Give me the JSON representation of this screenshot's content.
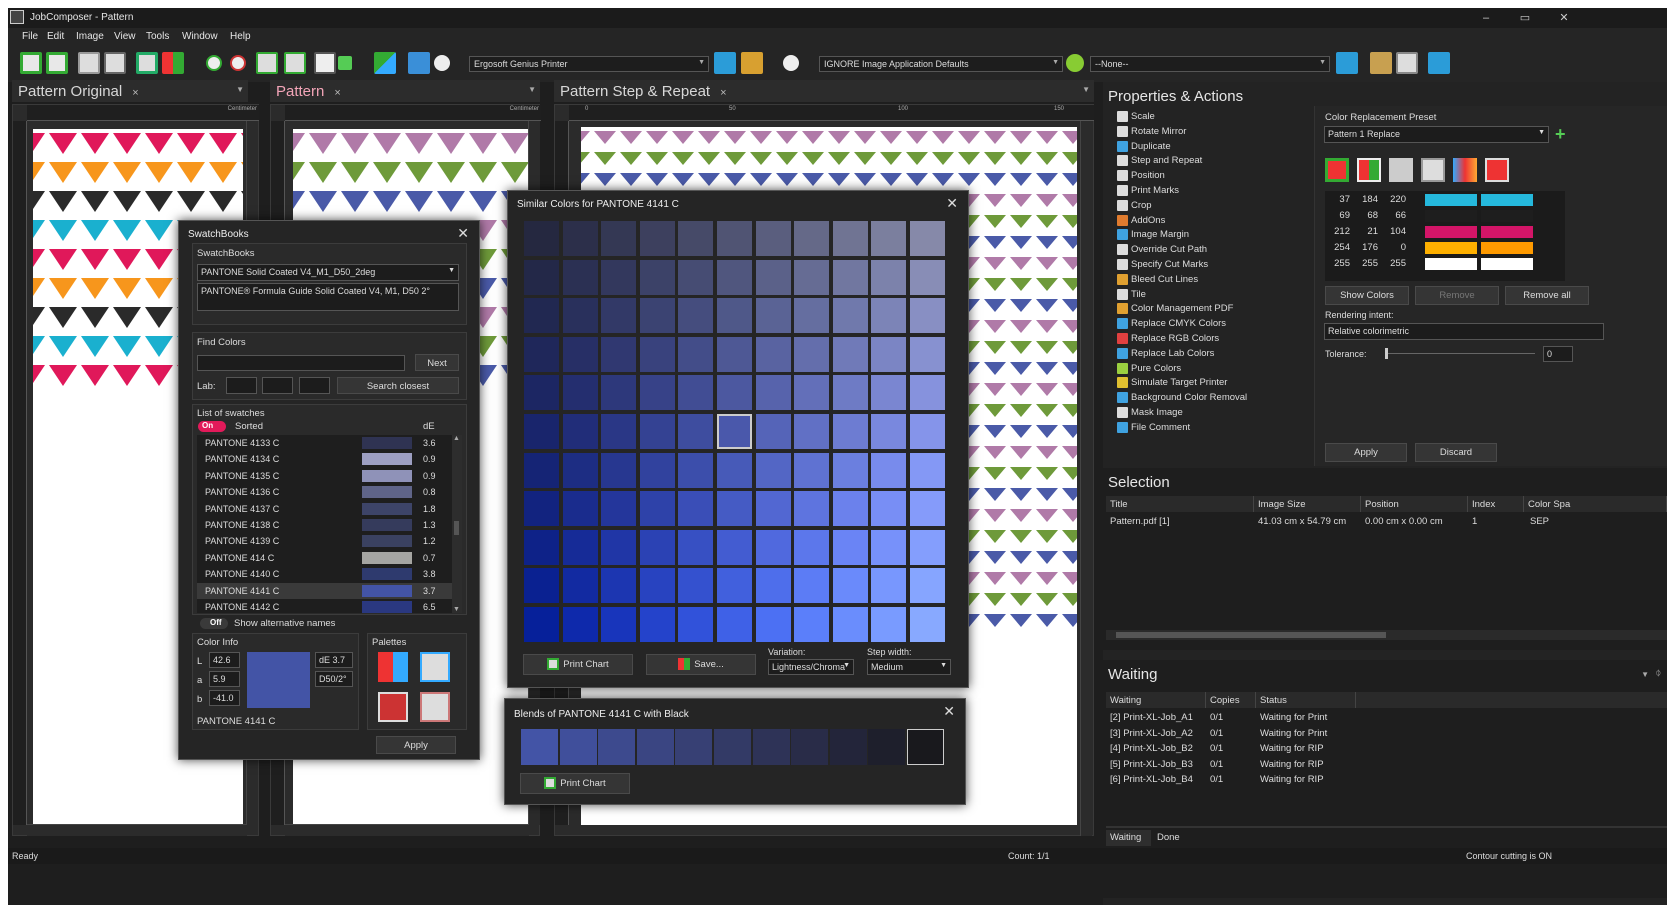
{
  "window": {
    "title": "JobComposer - Pattern",
    "controls": [
      "–",
      "▭",
      "✕"
    ]
  },
  "menu": [
    "File",
    "Edit",
    "Image",
    "View",
    "Tools",
    "Window",
    "Help"
  ],
  "toolbar": {
    "printer": "Ergosoft Genius Printer",
    "image_app": "IGNORE Image Application Defaults",
    "none": "--None--"
  },
  "tabs": [
    {
      "label": "Pattern Original",
      "close": "×"
    },
    {
      "label": "Pattern",
      "close": "×"
    },
    {
      "label": "Pattern Step & Repeat",
      "close": "×"
    }
  ],
  "ruler": {
    "unit": "Centimeter",
    "ticks": [
      "0",
      "50",
      "100",
      "150"
    ]
  },
  "swatchbooks": {
    "title": "SwatchBooks",
    "close": "✕",
    "group": "SwatchBooks",
    "book": "PANTONE Solid Coated V4_M1_D50_2deg",
    "book_desc": "PANTONE® Formula Guide Solid Coated V4, M1, D50 2°",
    "find_title": "Find Colors",
    "find_value": "",
    "next": "Next",
    "lab_label": "Lab:",
    "search_closest": "Search closest",
    "list_title": "List of swatches",
    "toggle_on": "On",
    "sorted": "Sorted",
    "de_header": "dE",
    "swatches": [
      {
        "name": "PANTONE 4133 C",
        "de": "3.6",
        "color": "#2f3352"
      },
      {
        "name": "PANTONE 4134 C",
        "de": "0.9",
        "color": "#9d9fc2"
      },
      {
        "name": "PANTONE 4135 C",
        "de": "0.9",
        "color": "#8f92b8"
      },
      {
        "name": "PANTONE 4136 C",
        "de": "0.8",
        "color": "#5f6488"
      },
      {
        "name": "PANTONE 4137 C",
        "de": "1.8",
        "color": "#3d4468"
      },
      {
        "name": "PANTONE 4138 C",
        "de": "1.3",
        "color": "#353b5c"
      },
      {
        "name": "PANTONE 4139 C",
        "de": "1.2",
        "color": "#3a4160"
      },
      {
        "name": "PANTONE 414 C",
        "de": "0.7",
        "color": "#a5a5a2"
      },
      {
        "name": "PANTONE 4140 C",
        "de": "3.8",
        "color": "#2e3a6e"
      },
      {
        "name": "PANTONE 4141 C",
        "de": "3.7",
        "color": "#4354a6"
      },
      {
        "name": "PANTONE 4142 C",
        "de": "6.5",
        "color": "#2a3880"
      }
    ],
    "toggle_off": "Off",
    "alt_names": "Show alternative names",
    "color_info": "Color Info",
    "L": "42.6",
    "a": "5.9",
    "b": "-41.0",
    "L_label": "L",
    "a_label": "a",
    "b_label": "b",
    "de_value": "dE 3.7",
    "illum": "D50/2°",
    "color_name": "PANTONE 4141 C",
    "preview_color": "#4354a6",
    "palettes": "Palettes",
    "apply": "Apply"
  },
  "similar": {
    "title": "Similar Colors for PANTONE 4141 C",
    "close": "✕",
    "print_chart": "Print Chart",
    "save": "Save...",
    "variation_label": "Variation:",
    "variation": "Lightness/Chroma",
    "step_label": "Step width:",
    "step": "Medium",
    "grid": [
      [
        "#252840",
        "#2c2f4a",
        "#343854",
        "#3d405e",
        "#464a68",
        "#505473",
        "#5a5e7e",
        "#656988",
        "#707493",
        "#7b7f9e",
        "#8689a9"
      ],
      [
        "#232848",
        "#2b3053",
        "#33385d",
        "#3c4268",
        "#464c73",
        "#50567e",
        "#5b6189",
        "#666c94",
        "#7177a0",
        "#7c82ab",
        "#888db6"
      ],
      [
        "#212851",
        "#29305c",
        "#323967",
        "#3b4372",
        "#454d7e",
        "#4f5889",
        "#5a6395",
        "#656ea0",
        "#7079ac",
        "#7c84b7",
        "#888fc3"
      ],
      [
        "#1f275a",
        "#272f66",
        "#303871",
        "#39427d",
        "#434d89",
        "#4e5895",
        "#5963a1",
        "#646eac",
        "#707ab8",
        "#7b85c4",
        "#8791d0"
      ],
      [
        "#1c2663",
        "#242e6f",
        "#2d387b",
        "#374288",
        "#414d94",
        "#4c58a0",
        "#5763ac",
        "#636fb9",
        "#6e7bc5",
        "#7a86d1",
        "#8692dd"
      ],
      [
        "#19256c",
        "#212d79",
        "#2a3786",
        "#344293",
        "#3e4d9f",
        "#4a58ab",
        "#5564b8",
        "#6170c5",
        "#6d7cd2",
        "#7988de",
        "#8594ea"
      ],
      [
        "#152475",
        "#1d2d83",
        "#273790",
        "#31429e",
        "#3c4eab",
        "#475ab8",
        "#5366c5",
        "#5f72d2",
        "#6b7fdf",
        "#788bec",
        "#8498f5"
      ],
      [
        "#12237f",
        "#1a2c8d",
        "#24369b",
        "#2e42a9",
        "#3a4eb7",
        "#455bc4",
        "#5267d2",
        "#5e74df",
        "#6b81ec",
        "#788ef5",
        "#859bfa"
      ],
      [
        "#0e2288",
        "#162b97",
        "#2036a6",
        "#2b42b4",
        "#3750c3",
        "#435cd1",
        "#5069de",
        "#5c77eb",
        "#6a84f5",
        "#7791fa",
        "#849efd"
      ],
      [
        "#0a2191",
        "#122aa1",
        "#1c36b1",
        "#2843c0",
        "#3451cf",
        "#4160dd",
        "#4e6eeb",
        "#5c7cf5",
        "#6a8afb",
        "#7897fe",
        "#86a5ff"
      ],
      [
        "#06209a",
        "#0e29ab",
        "#1835bb",
        "#2443cb",
        "#3152da",
        "#3f61e7",
        "#4c70f3",
        "#5b7ffa",
        "#6a8dfd",
        "#799bff",
        "#88a9ff"
      ]
    ]
  },
  "blends": {
    "title": "Blends of PANTONE 4141 C with Black",
    "close": "✕",
    "print_chart": "Print Chart",
    "colors": [
      "#4354a6",
      "#404f9b",
      "#3d4a8e",
      "#3a4582",
      "#374074",
      "#333a66",
      "#2e3357",
      "#292c48",
      "#23253a",
      "#1e1f2c",
      "#19191d"
    ]
  },
  "properties": {
    "title": "Properties & Actions",
    "items": [
      {
        "label": "Scale",
        "icon": "scale-icon",
        "color": "#dddddd"
      },
      {
        "label": "Rotate Mirror",
        "icon": "rotate-icon",
        "color": "#dddddd"
      },
      {
        "label": "Duplicate",
        "icon": "duplicate-icon",
        "color": "#3fa2e0"
      },
      {
        "label": "Step and Repeat",
        "icon": "step-repeat-icon",
        "color": "#dddddd"
      },
      {
        "label": "Position",
        "icon": "position-icon",
        "color": "#dddddd"
      },
      {
        "label": "Print Marks",
        "icon": "print-marks-icon",
        "color": "#dddddd"
      },
      {
        "label": "Crop",
        "icon": "crop-icon",
        "color": "#dddddd"
      },
      {
        "label": "AddOns",
        "icon": "addons-icon",
        "color": "#e07b2e"
      },
      {
        "label": "Image Margin",
        "icon": "image-margin-icon",
        "color": "#3fa2e0"
      },
      {
        "label": "Override Cut Path",
        "icon": "cut-path-icon",
        "color": "#dddddd"
      },
      {
        "label": "Specify Cut Marks",
        "icon": "cut-marks-icon",
        "color": "#dddddd"
      },
      {
        "label": "Bleed Cut Lines",
        "icon": "bleed-icon",
        "color": "#e0a030"
      },
      {
        "label": "Tile",
        "icon": "tile-icon",
        "color": "#dddddd"
      },
      {
        "label": "Color Management PDF",
        "icon": "color-management-icon",
        "color": "#e0a030"
      },
      {
        "label": "Replace CMYK Colors",
        "icon": "replace-cmyk-icon",
        "color": "#3fa2e0"
      },
      {
        "label": "Replace RGB Colors",
        "icon": "replace-rgb-icon",
        "color": "#e04040"
      },
      {
        "label": "Replace Lab Colors",
        "icon": "replace-lab-icon",
        "color": "#3fa2e0"
      },
      {
        "label": "Pure Colors",
        "icon": "pure-colors-icon",
        "color": "#9bd040"
      },
      {
        "label": "Simulate Target Printer",
        "icon": "simulate-icon",
        "color": "#e0c030"
      },
      {
        "label": "Background Color Removal",
        "icon": "bg-removal-icon",
        "color": "#3fa2e0"
      },
      {
        "label": "Mask Image",
        "icon": "mask-icon",
        "color": "#dddddd"
      },
      {
        "label": "File Comment",
        "icon": "comment-icon",
        "color": "#3fa2e0"
      }
    ],
    "preset_label": "Color Replacement Preset",
    "preset": "Pattern 1 Replace",
    "colors": [
      {
        "r": "37",
        "g": "184",
        "b": "220",
        "c1": "#25b8dc",
        "c2": "#25b8dc"
      },
      {
        "r": "69",
        "g": "68",
        "b": "66",
        "c1": "#1e1e1e",
        "c2": "#1e1e1e"
      },
      {
        "r": "212",
        "g": "21",
        "b": "104",
        "c1": "#d41568",
        "c2": "#d41568"
      },
      {
        "r": "254",
        "g": "176",
        "b": "0",
        "c1": "#feb000",
        "c2": "#fe9a00"
      },
      {
        "r": "255",
        "g": "255",
        "b": "255",
        "c1": "#ffffff",
        "c2": "#ffffff"
      }
    ],
    "show_colors": "Show Colors",
    "remove": "Remove",
    "remove_all": "Remove all",
    "rendering_label": "Rendering intent:",
    "rendering": "Relative colorimetric",
    "tolerance_label": "Tolerance:",
    "tolerance": "0",
    "apply": "Apply",
    "discard": "Discard"
  },
  "selection": {
    "title": "Selection",
    "headers": [
      "Title",
      "Image Size",
      "Position",
      "Index",
      "Color Spa"
    ],
    "row": [
      "Pattern.pdf [1]",
      "41.03 cm x 54.79 cm",
      "0.00 cm x 0.00 cm",
      "1",
      "SEP"
    ]
  },
  "waiting": {
    "title": "Waiting",
    "headers": [
      "Waiting",
      "Copies",
      "Status"
    ],
    "rows": [
      [
        "[2]  Print-XL-Job_A1",
        "0/1",
        "Waiting for Print"
      ],
      [
        "[3]  Print-XL-Job_A2",
        "0/1",
        "Waiting for Print"
      ],
      [
        "[4]  Print-XL-Job_B2",
        "0/1",
        "Waiting for RIP"
      ],
      [
        "[5]  Print-XL-Job_B3",
        "0/1",
        "Waiting for RIP"
      ],
      [
        "[6]  Print-XL-Job_B4",
        "0/1",
        "Waiting for RIP"
      ]
    ],
    "tab_waiting": "Waiting",
    "tab_done": "Done"
  },
  "status": {
    "left": "Ready",
    "count": "Count: 1/1",
    "right": "Contour cutting is ON"
  },
  "pattern_colors": {
    "original": [
      "#e0185a",
      "#f7961c",
      "#2a2a2a",
      "#1ab0cf",
      "#e0185a",
      "#f7961c",
      "#2a2a2a",
      "#1ab0cf"
    ],
    "pattern": [
      "#b07aa8",
      "#6e9a3a",
      "#4a5aa8"
    ],
    "step": [
      "#b07aa8",
      "#6e9a3a",
      "#4a5aa8"
    ]
  }
}
